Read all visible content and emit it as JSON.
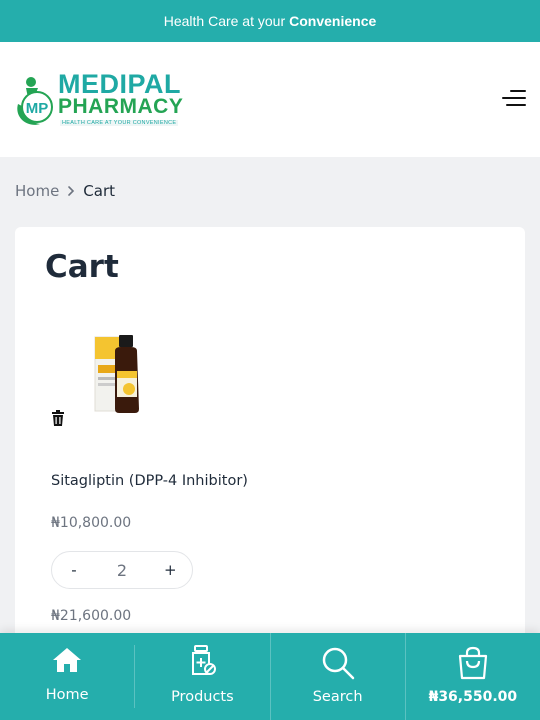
{
  "topbar": {
    "text": "Health Care at your",
    "bold": "Convenience"
  },
  "logo": {
    "mark": "MP",
    "line1": "MEDIPAL",
    "line2": "PHARMACY",
    "tagline": "HEALTH CARE AT YOUR CONVENIENCE"
  },
  "breadcrumb": {
    "home": "Home",
    "current": "Cart"
  },
  "page": {
    "title": "Cart"
  },
  "cart": {
    "items": [
      {
        "name": "Sitagliptin (DPP-4 Inhibitor)",
        "price": "₦10,800.00",
        "quantity": "2",
        "decrement": "-",
        "increment": "+",
        "subtotal": "₦21,600.00"
      }
    ]
  },
  "bottom_nav": {
    "items": [
      {
        "label": "Home",
        "icon": "home-icon"
      },
      {
        "label": "Products",
        "icon": "medicine-bottle-icon"
      },
      {
        "label": "Search",
        "icon": "search-icon"
      },
      {
        "label": "₦36,550.00",
        "icon": "shopping-bag-icon"
      }
    ]
  },
  "colors": {
    "brand_teal": "#25aeac",
    "logo_green": "#24a454",
    "text_dark": "#1f2b3a",
    "text_muted": "#6d7480"
  }
}
